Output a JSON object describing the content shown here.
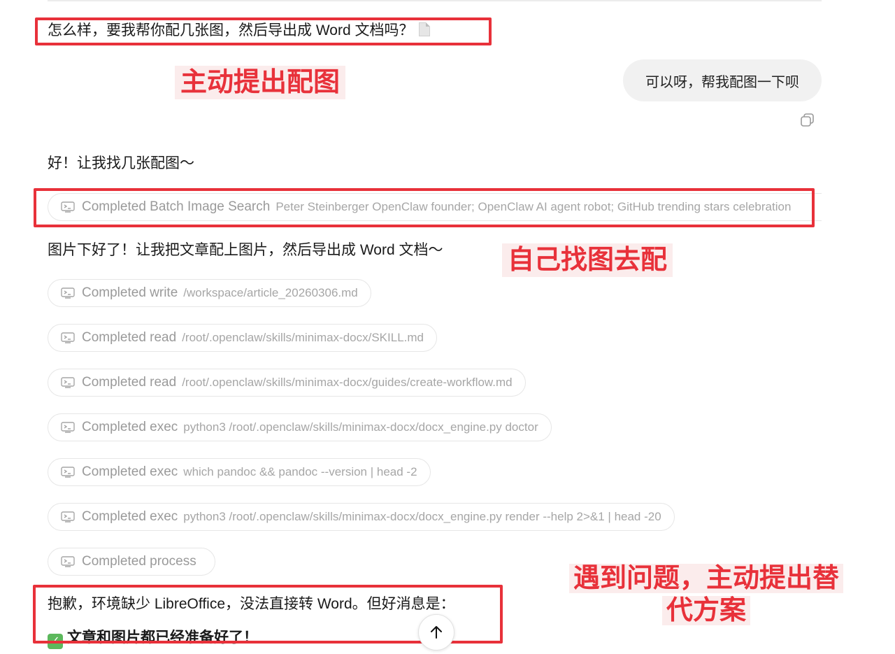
{
  "messages": {
    "assistant_offer": "怎么样，要我帮你配几张图，然后导出成 Word 文档吗？",
    "user_reply": "可以呀，帮我配图一下呗",
    "assistant_ack": "好！让我找几张配图～",
    "assistant_images_done": "图片下好了！让我把文章配上图片，然后导出成 Word 文档～",
    "assistant_sorry": "抱歉，环境缺少 LibreOffice，没法直接转 Word。但好消息是：",
    "assistant_ready": "文章和图片都已经准备好了！"
  },
  "tool_calls": [
    {
      "status": "Completed Batch Image Search",
      "detail": "Peter Steinberger OpenClaw founder; OpenClaw AI agent robot; GitHub trending stars celebration"
    },
    {
      "status": "Completed write",
      "detail": "/workspace/article_20260306.md"
    },
    {
      "status": "Completed read",
      "detail": "/root/.openclaw/skills/minimax-docx/SKILL.md"
    },
    {
      "status": "Completed read",
      "detail": "/root/.openclaw/skills/minimax-docx/guides/create-workflow.md"
    },
    {
      "status": "Completed exec",
      "detail": "python3 /root/.openclaw/skills/minimax-docx/docx_engine.py doctor"
    },
    {
      "status": "Completed exec",
      "detail": "which pandoc && pandoc --version | head -2"
    },
    {
      "status": "Completed exec",
      "detail": "python3 /root/.openclaw/skills/minimax-docx/docx_engine.py render --help 2>&1 | head -20"
    },
    {
      "status": "Completed process",
      "detail": ""
    }
  ],
  "annotations": {
    "proactive_image": "主动提出配图",
    "find_images": "自己找图去配",
    "alternative_line1": "遇到问题，主动提出替",
    "alternative_line2": "代方案"
  },
  "icons": {
    "tool": "terminal-icon",
    "copy": "copy-icon",
    "document": "document-icon",
    "check": "checkmark-icon",
    "scroll": "arrow-up-icon"
  },
  "colors": {
    "annotation_red": "#e8313a",
    "annotation_bg": "#fbecec",
    "user_bubble_bg": "#f1f1f1",
    "tool_text": "#9a9a9a",
    "check_green": "#5cb85c"
  }
}
